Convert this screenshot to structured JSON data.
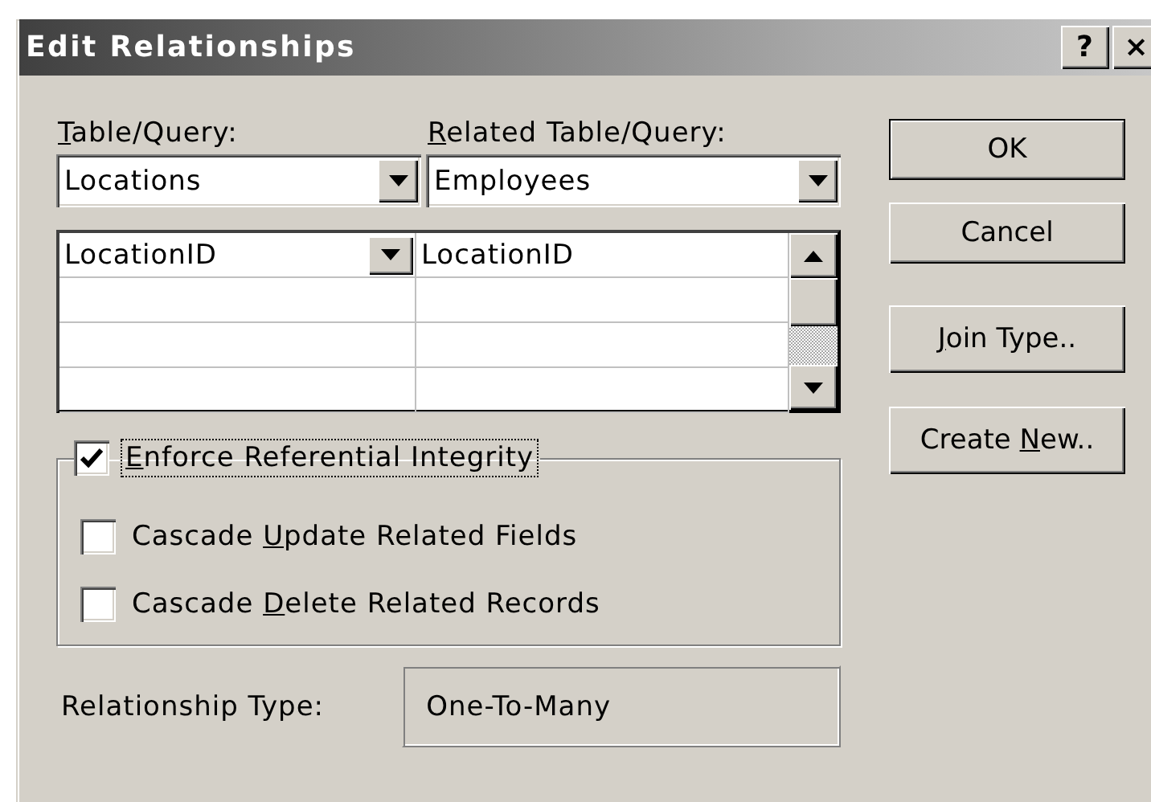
{
  "window": {
    "title": "Edit Relationships",
    "title_buttons": [
      "?",
      "×"
    ]
  },
  "table_query": {
    "label": {
      "key": "T",
      "post": "able/Query:"
    },
    "value": "Locations"
  },
  "related_table_query": {
    "label": {
      "key": "R",
      "post": "elated Table/Query:"
    },
    "value": "Employees"
  },
  "field_grid": {
    "rows": [
      {
        "field": "LocationID",
        "related_field": "LocationID",
        "current": true
      }
    ]
  },
  "options": [
    {
      "label": {
        "key": "E",
        "post": "nforce Referential Integrity"
      },
      "checked": true,
      "focused": true
    },
    {
      "label": {
        "pre": "Cascade ",
        "key": "U",
        "post": "pdate Related Fields"
      },
      "checked": false,
      "focused": false
    },
    {
      "label": {
        "pre": "Cascade ",
        "key": "D",
        "post": "elete Related Records"
      },
      "checked": false,
      "focused": false
    }
  ],
  "relationship_type": {
    "label": "Relationship Type:",
    "value": "One-To-Many"
  },
  "buttons": [
    {
      "label": {
        "pre": "OK"
      },
      "default": true
    },
    {
      "label": {
        "pre": "Cancel"
      },
      "default": false
    },
    {
      "label": {
        "key": "J",
        "post": "oin Type.."
      },
      "default": false
    },
    {
      "label": {
        "pre": "Create ",
        "key": "N",
        "post": "ew.."
      },
      "default": false
    }
  ]
}
